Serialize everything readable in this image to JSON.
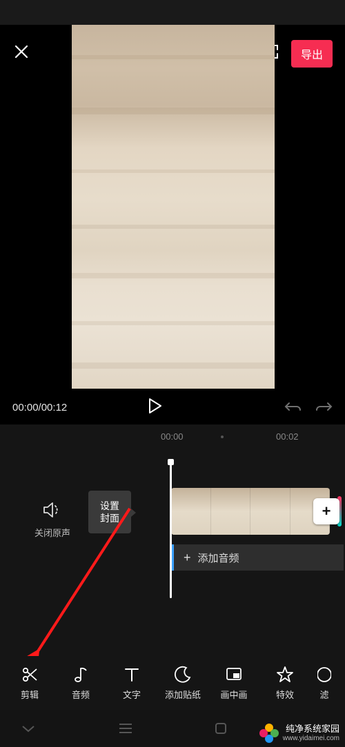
{
  "header": {
    "export_label": "导出"
  },
  "player": {
    "current_time": "00:00",
    "total_time": "00:12"
  },
  "timeline": {
    "ruler": [
      "00:00",
      "00:02"
    ],
    "mute_label": "关闭原声",
    "cover_label": "设置\n封面",
    "add_audio_label": "添加音频"
  },
  "toolbar": {
    "items": [
      {
        "name": "edit-tool",
        "label": "剪辑",
        "icon": "scissors-icon"
      },
      {
        "name": "audio-tool",
        "label": "音频",
        "icon": "music-note-icon"
      },
      {
        "name": "text-tool",
        "label": "文字",
        "icon": "text-icon"
      },
      {
        "name": "sticker-tool",
        "label": "添加贴纸",
        "icon": "moon-icon"
      },
      {
        "name": "pip-tool",
        "label": "画中画",
        "icon": "picture-in-picture-icon"
      },
      {
        "name": "effects-tool",
        "label": "特效",
        "icon": "star-icon"
      },
      {
        "name": "filter-tool",
        "label": "滤",
        "icon": "circle-icon"
      }
    ]
  },
  "watermark": {
    "title": "纯净系统家园",
    "url": "www.yidaimei.com"
  }
}
